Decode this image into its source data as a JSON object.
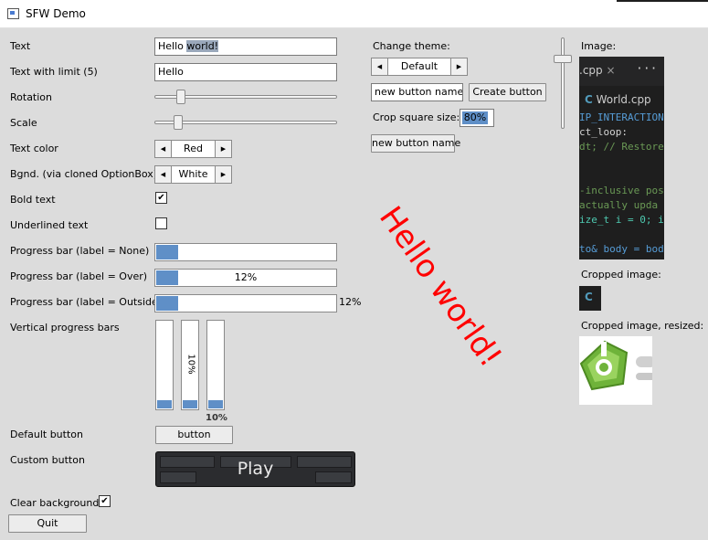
{
  "window": {
    "title": "SFW Demo"
  },
  "labels": {
    "text": "Text",
    "text_with_limit": "Text with limit (5)",
    "rotation": "Rotation",
    "scale": "Scale",
    "text_color": "Text color",
    "bgnd": "Bgnd. (via cloned OptionBox)",
    "bold_text": "Bold text",
    "underlined_text": "Underlined text",
    "pb_none": "Progress bar (label = None)",
    "pb_over": "Progress bar (label = Over)",
    "pb_outside": "Progress bar (label = Outside)",
    "vertical_pbs": "Vertical progress bars",
    "default_button": "Default button",
    "custom_button": "Custom button",
    "clear_background": "Clear background"
  },
  "inputs": {
    "text_value_a": "Hello ",
    "text_value_b": "world!",
    "text_limit_value": "Hello"
  },
  "sliders": {
    "rotation": 0.14,
    "scale": 0.1
  },
  "option_boxes": {
    "text_color": "Red",
    "background": "White",
    "theme": "Default"
  },
  "checkboxes": {
    "bold": true,
    "underlined": false,
    "clear_background": true
  },
  "progress": {
    "value": 0.12,
    "label": "12%",
    "vertical_label": "10%",
    "vertical_outside_label": "10%",
    "vertical_value": 0.1
  },
  "buttons": {
    "default": "button",
    "custom": "Play",
    "quit": "Quit",
    "create": "Create button"
  },
  "middle": {
    "change_theme": "Change theme:",
    "new_button_field": "new button name",
    "crop_label": "Crop square size:",
    "crop_value": "80%",
    "new_button_created": "new button name"
  },
  "canvas_text": "Hello world!",
  "images": {
    "image_label": "Image:",
    "cropped_label": "Cropped image:",
    "cropped_resized_label": "Cropped image, resized:",
    "code_tab": ".cpp",
    "code_tab_close": "×",
    "code_tab_more": "···",
    "code_file": "World.cpp",
    "code_lines": [
      "IP_INTERACTION",
      "ct_loop:",
      "dt; // Restore",
      "",
      "",
      "-inclusive pos",
      " actually upda",
      "ize_t i = 0; i",
      "",
      "to& body = bod"
    ]
  },
  "colors": {
    "canvas_text": "#ff0000",
    "progress_fill": "#5f8fc7",
    "window_bg": "#dcdcdc",
    "code_bg": "#1e1e1e",
    "logo_green": "#6fb33a"
  }
}
